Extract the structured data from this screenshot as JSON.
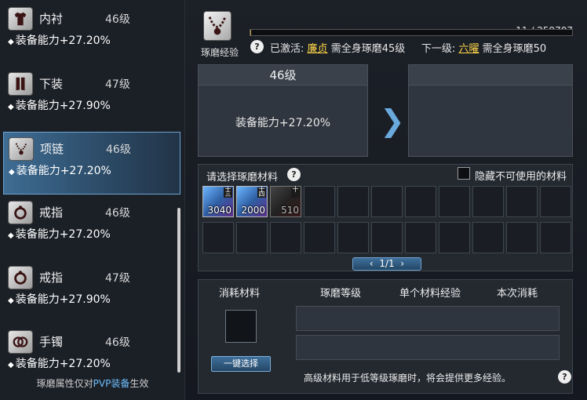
{
  "slots": [
    {
      "name": "内衬",
      "level": "46级",
      "stat": "装备能力+27.20%",
      "icon": "shirt-icon",
      "selected": false
    },
    {
      "name": "下装",
      "level": "47级",
      "stat": "装备能力+27.90%",
      "icon": "pants-icon",
      "selected": false
    },
    {
      "name": "项链",
      "level": "46级",
      "stat": "装备能力+27.20%",
      "icon": "necklace-icon",
      "selected": true
    },
    {
      "name": "戒指",
      "level": "46级",
      "stat": "装备能力+27.20%",
      "icon": "ring-icon",
      "selected": false
    },
    {
      "name": "戒指",
      "level": "47级",
      "stat": "装备能力+27.90%",
      "icon": "ring-icon",
      "selected": false
    },
    {
      "name": "手镯",
      "level": "46级",
      "stat": "装备能力+27.20%",
      "icon": "bracelet-icon",
      "selected": false
    }
  ],
  "left_footer": {
    "pre": "琢磨属性仅对",
    "hl": "PVP装备",
    "post": "生效"
  },
  "exp": {
    "label": "琢磨经验",
    "current": "11",
    "total": "259707",
    "fraction": 4e-05
  },
  "active": {
    "prefix": "已激活:",
    "cur_name": "廉贞",
    "cur_req": "需全身琢磨45级",
    "next_prefix": "下一级:",
    "next_name": "六曜",
    "next_req": "需全身琢磨50"
  },
  "current_box": {
    "level": "46级",
    "stat": "装备能力+27.20%"
  },
  "next_box": {
    "level": "",
    "stat": ""
  },
  "materials": {
    "title": "请选择琢磨材料",
    "hide_label": "隐藏不可使用的材料",
    "items": [
      {
        "count": "3040",
        "tag": "十三",
        "dim": false
      },
      {
        "count": "2000",
        "tag": "十四",
        "dim": false
      },
      {
        "count": "510",
        "tag": "十",
        "dim": true
      }
    ],
    "page": "1/1"
  },
  "consume": {
    "headers": [
      "消耗材料",
      "琢磨等级",
      "单个材料经验",
      "本次消耗"
    ],
    "one_key": "一键选择",
    "hint": "高级材料用于低等级琢磨时，将会提供更多经验。"
  },
  "colors": {
    "accent": "#6aa9dc",
    "link": "#ffd84a",
    "exp_bar": "#c9a640",
    "pvp": "#6fc0ff"
  }
}
